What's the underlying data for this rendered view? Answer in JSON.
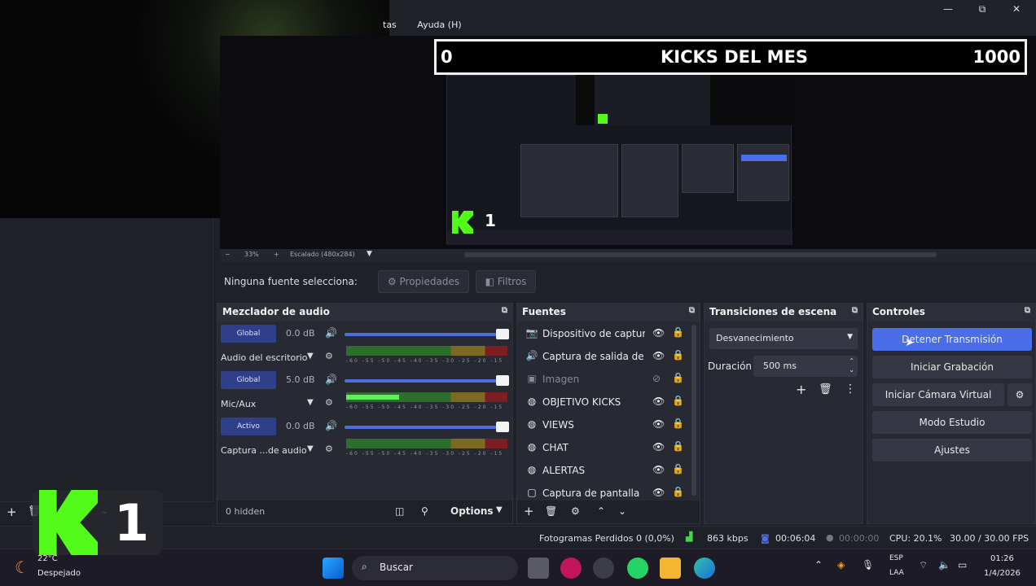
{
  "menu": {
    "items": [
      "tas",
      "Ayuda (H)"
    ]
  },
  "window": {
    "minimize": "—",
    "maximize": "⧉",
    "close": "✕"
  },
  "preview": {
    "overlay": {
      "left": "0",
      "title": "KICKS DEL MES",
      "right": "1000"
    },
    "mini_k_number": "1"
  },
  "zoombar": {
    "minus": "−",
    "zoom": "33%",
    "plus": "+",
    "scale": "Escalado (480x284)"
  },
  "properties_bar": {
    "no_selection": "Ninguna fuente selecciona:",
    "properties_btn": "Propiedades",
    "filters_btn": "Filtros"
  },
  "mixer": {
    "title": "Mezclador de audio",
    "channels": [
      {
        "badge": "Global",
        "db": "0.0 dB",
        "name": "Audio del escritorio",
        "level": 0
      },
      {
        "badge": "Global",
        "db": "5.0 dB",
        "name": "Mic/Aux",
        "level": 0.33
      },
      {
        "badge": "Activo",
        "db": "0.0 dB",
        "name": "Captura ...de audio",
        "level": 0
      }
    ],
    "ticks": "-60 -55 -50 -45 -40 -35 -30 -25 -20 -15 -10 -5 0",
    "footer": {
      "hidden": "0 hidden",
      "options": "Options"
    }
  },
  "sources": {
    "title": "Fuentes",
    "items": [
      {
        "icon": "camera-icon",
        "glyph": "📷",
        "label": "Dispositivo de captura",
        "visible": true
      },
      {
        "icon": "speaker-icon",
        "glyph": "🔊",
        "label": "Captura de salida de au",
        "visible": true
      },
      {
        "icon": "image-icon",
        "glyph": "▣",
        "label": "Imagen",
        "visible": false
      },
      {
        "icon": "globe-icon",
        "glyph": "◍",
        "label": "OBJETIVO KICKS",
        "visible": true
      },
      {
        "icon": "globe-icon",
        "glyph": "◍",
        "label": "VIEWS",
        "visible": true
      },
      {
        "icon": "globe-icon",
        "glyph": "◍",
        "label": "CHAT",
        "visible": true
      },
      {
        "icon": "globe-icon",
        "glyph": "◍",
        "label": "ALERTAS",
        "visible": true
      },
      {
        "icon": "monitor-icon",
        "glyph": "▢",
        "label": "Captura de pantalla",
        "visible": true
      }
    ]
  },
  "transitions": {
    "title": "Transiciones de escena",
    "selected": "Desvanecimiento",
    "duration_label": "Duración",
    "duration_value": "500 ms"
  },
  "controls": {
    "title": "Controles",
    "stop_stream": "Detener Transmisión",
    "start_record": "Iniciar Grabación",
    "start_vcam": "Iniciar Cámara Virtual",
    "studio_mode": "Modo Estudio",
    "settings": "Ajustes"
  },
  "status": {
    "dropped": "Fotogramas Perdidos 0 (0,0%)",
    "bitrate": "863 kbps",
    "live_time": "00:06:04",
    "rec_time": "00:00:00",
    "cpu": "CPU: 20.1%",
    "fps": "30.00 / 30.00 FPS"
  },
  "overlay_logo": {
    "number": "1"
  },
  "taskbar": {
    "weather_temp": "22°C",
    "weather_text": "Despejado",
    "search": "Buscar",
    "lang1": "ESP",
    "lang2": "LAA",
    "time": "01:26",
    "date": "1/4/2026"
  },
  "colors": {
    "accent_blue": "#4a6ee8",
    "kick_green": "#53fc18",
    "panel_bg": "#272a33"
  }
}
